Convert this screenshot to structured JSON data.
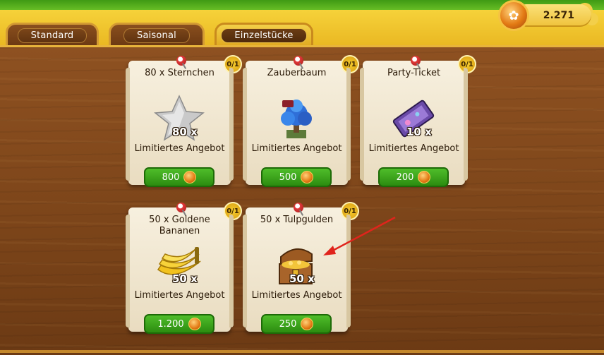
{
  "tabs": [
    {
      "label": "Standard",
      "active": false
    },
    {
      "label": "Saisonal",
      "active": false
    },
    {
      "label": "Einzelstücke",
      "active": true
    }
  ],
  "coins": {
    "amount": "2.271",
    "icon": "coin-icon"
  },
  "cards": [
    {
      "title": "80 x Sternchen",
      "limit": "0/1",
      "qty": "80 x",
      "offer": "Limitiertes Angebot",
      "price": "800",
      "icon": "star-icon"
    },
    {
      "title": "Zauberbaum",
      "limit": "0/1",
      "qty": "",
      "offer": "Limitiertes Angebot",
      "price": "500",
      "icon": "magic-tree-icon"
    },
    {
      "title": "Party-Ticket",
      "limit": "0/1",
      "qty": "10 x",
      "offer": "Limitiertes Angebot",
      "price": "200",
      "icon": "party-ticket-icon"
    },
    {
      "title": "50 x Goldene Bananen",
      "limit": "0/1",
      "qty": "50 x",
      "offer": "Limitiertes Angebot",
      "price": "1.200",
      "icon": "golden-bananas-icon"
    },
    {
      "title": "50 x Tulpgulden",
      "limit": "0/1",
      "qty": "50 x",
      "offer": "Limitiertes Angebot",
      "price": "250",
      "icon": "treasure-chest-icon"
    }
  ],
  "colors": {
    "annotation_arrow": "#e0241c",
    "buy_button": "#2c8c10",
    "wood": "#7b4419",
    "header": "#f6d23a"
  }
}
